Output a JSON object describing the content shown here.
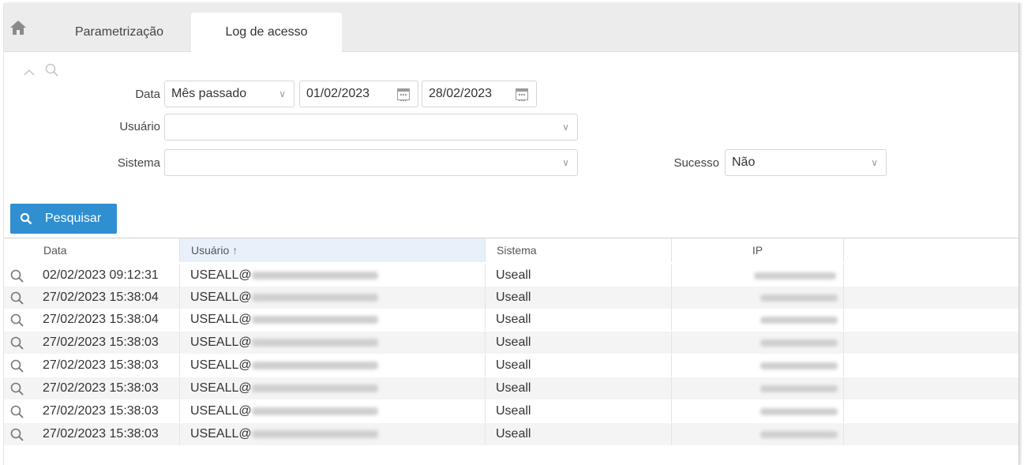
{
  "tabs": [
    {
      "label": "Parametrização",
      "active": false
    },
    {
      "label": "Log de acesso",
      "active": true
    }
  ],
  "filters": {
    "data_label": "Data",
    "data_period": "Mês passado",
    "date_from": "01/02/2023",
    "date_to": "28/02/2023",
    "usuario_label": "Usuário",
    "usuario_value": "",
    "sistema_label": "Sistema",
    "sistema_value": "",
    "sucesso_label": "Sucesso",
    "sucesso_value": "Não"
  },
  "search_button": "Pesquisar",
  "grid": {
    "columns": [
      "Data",
      "Usuário",
      "Sistema",
      "IP"
    ],
    "sorted_column": "Usuário",
    "rows": [
      {
        "data": "02/02/2023 09:12:31",
        "usuario": "USEALL@",
        "sistema": "Useall"
      },
      {
        "data": "27/02/2023 15:38:04",
        "usuario": "USEALL@",
        "sistema": "Useall"
      },
      {
        "data": "27/02/2023 15:38:04",
        "usuario": "USEALL@",
        "sistema": "Useall"
      },
      {
        "data": "27/02/2023 15:38:03",
        "usuario": "USEALL@",
        "sistema": "Useall"
      },
      {
        "data": "27/02/2023 15:38:03",
        "usuario": "USEALL@",
        "sistema": "Useall"
      },
      {
        "data": "27/02/2023 15:38:03",
        "usuario": "USEALL@",
        "sistema": "Useall"
      },
      {
        "data": "27/02/2023 15:38:03",
        "usuario": "USEALL@",
        "sistema": "Useall"
      },
      {
        "data": "27/02/2023 15:38:03",
        "usuario": "USEALL@",
        "sistema": "Useall"
      }
    ]
  },
  "colors": {
    "accent": "#2f8fd1",
    "sorted_header": "#e8f1fa"
  },
  "icons": [
    "home-icon",
    "chevron-up-icon",
    "search-icon",
    "calendar-icon",
    "chevron-down-icon"
  ]
}
